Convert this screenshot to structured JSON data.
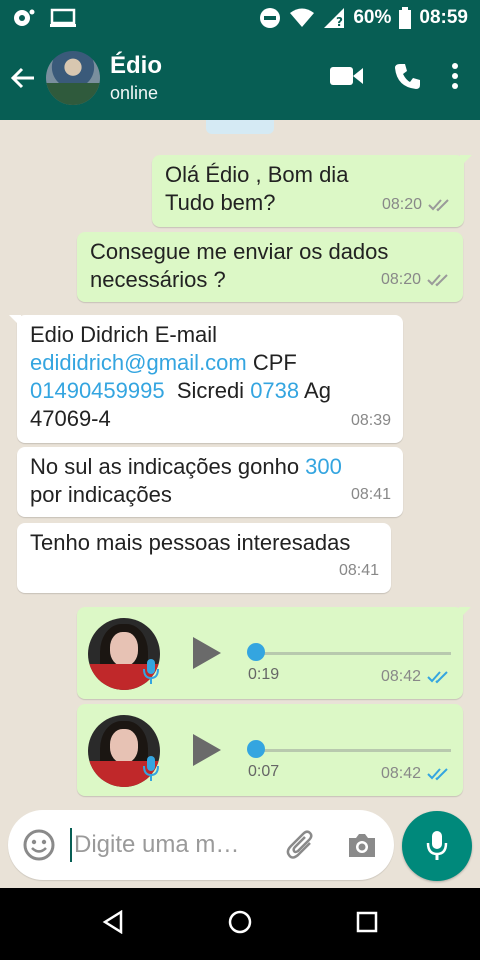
{
  "status_bar": {
    "battery": "60%",
    "time": "08:59"
  },
  "header": {
    "contact_name": "Édio",
    "contact_status": "online"
  },
  "messages": [
    {
      "direction": "out",
      "lines": [
        "Olá Édio , Bom dia",
        "Tudo bem?"
      ],
      "time": "08:20",
      "status": "delivered"
    },
    {
      "direction": "out",
      "lines": [
        "Consegue me enviar os dados",
        "necessários ?"
      ],
      "time": "08:20",
      "status": "delivered"
    },
    {
      "direction": "in",
      "line1": "Edio Didrich E-mail",
      "email": "edididrich@gmail.com",
      "cpf_label": " CPF",
      "cpf": "01490459995",
      "bank": "  Sicredi ",
      "agency_num": "0738",
      "ag_label": " Ag",
      "line4": "47069-4",
      "time": "08:39"
    },
    {
      "direction": "in",
      "text_a": "No sul as indicações gonho ",
      "number": "300",
      "text_b": "por indicações",
      "time": "08:41"
    },
    {
      "direction": "in",
      "text": "Tenho mais pessoas interesadas",
      "time": "08:41"
    },
    {
      "direction": "out",
      "type": "voice",
      "duration": "0:19",
      "time": "08:42",
      "status": "read",
      "progress": 0
    },
    {
      "direction": "out",
      "type": "voice",
      "duration": "0:07",
      "time": "08:42",
      "status": "read",
      "progress": 0
    }
  ],
  "composer": {
    "placeholder": "Digite uma m…"
  },
  "colors": {
    "header": "#075E54",
    "outgoing_bubble": "#dcf8c6",
    "incoming_bubble": "#ffffff",
    "link": "#34a5e0",
    "read_ticks": "#34a5e0",
    "mic_button": "#00897b"
  },
  "icons": [
    "back-arrow-icon",
    "video-call-icon",
    "phone-icon",
    "more-vert-icon",
    "emoji-icon",
    "attach-icon",
    "camera-icon",
    "mic-icon",
    "play-icon",
    "back-nav-icon",
    "home-nav-icon",
    "recents-nav-icon"
  ]
}
